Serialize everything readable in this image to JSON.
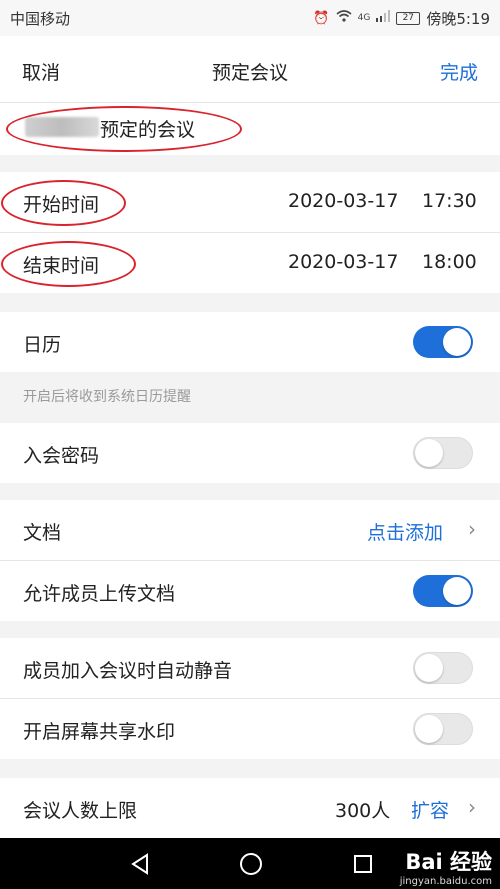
{
  "status": {
    "carrier": "中国移动",
    "battery": "27",
    "time": "傍晚5:19",
    "signal": "4G"
  },
  "nav": {
    "cancel": "取消",
    "title": "预定会议",
    "done": "完成"
  },
  "host": {
    "text": "预定的会议"
  },
  "start": {
    "label": "开始时间",
    "date": "2020-03-17",
    "time": "17:30"
  },
  "end": {
    "label": "结束时间",
    "date": "2020-03-17",
    "time": "18:00"
  },
  "calendar": {
    "label": "日历",
    "enabled": true,
    "hint": "开启后将收到系统日历提醒"
  },
  "password": {
    "label": "入会密码",
    "enabled": false
  },
  "document": {
    "label": "文档",
    "action": "点击添加"
  },
  "allow_upload": {
    "label": "允许成员上传文档",
    "enabled": true
  },
  "auto_mute": {
    "label": "成员加入会议时自动静音",
    "enabled": false
  },
  "watermark_setting": {
    "label": "开启屏幕共享水印",
    "enabled": false
  },
  "capacity": {
    "label": "会议人数上限",
    "value": "300人",
    "action": "扩容"
  },
  "watermark": {
    "brand": "Bai 经验",
    "site": "jingyan.baidu.com"
  },
  "colors": {
    "accent": "#1e6fd9",
    "annotation": "#d9232d"
  }
}
